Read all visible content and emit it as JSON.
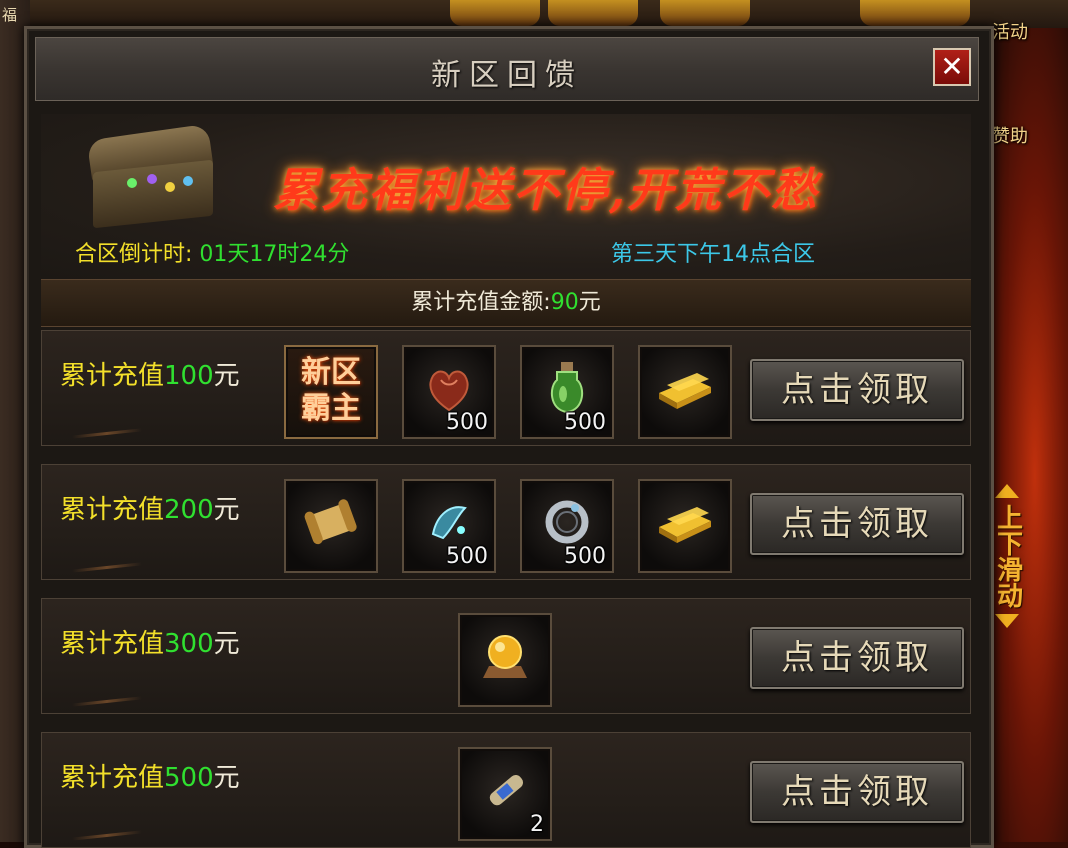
{
  "background": {
    "side_labels": {
      "fu": "福",
      "activity": "活动",
      "sponsor": "赞助"
    },
    "scroll_hint": "上下滑动"
  },
  "dialog": {
    "title": "新区回馈",
    "close_label": "✕"
  },
  "banner": {
    "slogan": "累充福利送不停,开荒不愁",
    "countdown_label": "合区倒计时:",
    "countdown_value": "01天17时24分",
    "merge_note": "第三天下午14点合区"
  },
  "total": {
    "label": "累计充值金额:",
    "amount": "90",
    "unit": "元"
  },
  "claim_label": "点击领取",
  "rows": [
    {
      "prefix": "累计充值",
      "amount": "100",
      "unit": "元",
      "items": [
        {
          "icon": "title-badge-icon",
          "badge": "新区\n霸主",
          "qty": ""
        },
        {
          "icon": "heart-organ-icon",
          "qty": "500"
        },
        {
          "icon": "green-potion-icon",
          "qty": "500"
        },
        {
          "icon": "gold-bar-icon",
          "qty": ""
        }
      ]
    },
    {
      "prefix": "累计充值",
      "amount": "200",
      "unit": "元",
      "items": [
        {
          "icon": "gold-scroll-icon",
          "qty": ""
        },
        {
          "icon": "blue-crystal-icon",
          "qty": "500"
        },
        {
          "icon": "silver-ring-icon",
          "qty": "500"
        },
        {
          "icon": "gold-bar-icon",
          "qty": ""
        }
      ]
    },
    {
      "prefix": "累计充值",
      "amount": "300",
      "unit": "元",
      "items": [
        {
          "icon": "golden-orb-icon",
          "qty": ""
        }
      ]
    },
    {
      "prefix": "累计充值",
      "amount": "500",
      "unit": "元",
      "items": [
        {
          "icon": "blue-scroll-icon",
          "qty": "2"
        }
      ]
    }
  ]
}
